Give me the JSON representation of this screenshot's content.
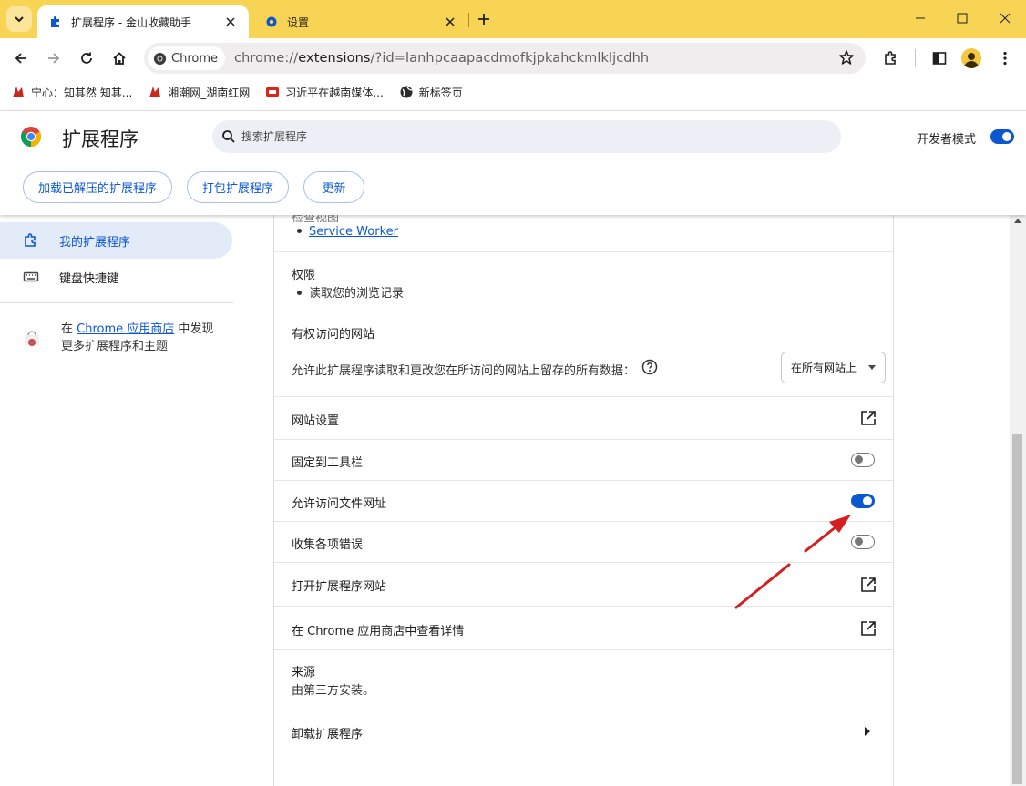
{
  "tabs": {
    "active_title": "扩展程序 - 金山收藏助手",
    "inactive_title": "设置"
  },
  "toolbar": {
    "chip_label": "Chrome",
    "url_scheme": "chrome://",
    "url_host": "extensions",
    "url_rest": "/?id=lanhpcaapacdmofkjpkahckmlkljcdhh"
  },
  "bookmarks": [
    {
      "label": "宁心：知其然 知其...",
      "icon": "brand-icon"
    },
    {
      "label": "湘潮网_湖南红网",
      "icon": "brand-icon"
    },
    {
      "label": "习近平在越南媒体...",
      "icon": "news-icon"
    },
    {
      "label": "新标签页",
      "icon": "globe-icon"
    }
  ],
  "header": {
    "title": "扩展程序",
    "search_placeholder": "搜索扩展程序",
    "dev_mode_label": "开发者模式",
    "dev_mode_on": true,
    "buttons": {
      "load_unpacked": "加载已解压的扩展程序",
      "pack": "打包扩展程序",
      "update": "更新"
    }
  },
  "sidebar": {
    "items": [
      {
        "label": "我的扩展程序",
        "active": true
      },
      {
        "label": "键盘快捷键",
        "active": false
      }
    ],
    "store_prefix": "在",
    "store_link": "Chrome 应用商店",
    "store_suffix": "中发现",
    "store_line2": "更多扩展程序和主题"
  },
  "details": {
    "inspect_heading": "检查视图",
    "service_worker": "Service Worker",
    "permissions_title": "权限",
    "permission_item": "读取您的浏览记录",
    "site_access_title": "有权访问的网站",
    "site_access_desc": "允许此扩展程序读取和更改您在所访问的网站上留存的所有数据：",
    "site_access_value": "在所有网站上",
    "site_settings": "网站设置",
    "pin_toolbar": "固定到工具栏",
    "pin_toolbar_on": false,
    "allow_file_urls": "允许访问文件网址",
    "allow_file_urls_on": true,
    "collect_errors": "收集各项错误",
    "collect_errors_on": false,
    "open_website": "打开扩展程序网站",
    "view_in_store": "在 Chrome 应用商店中查看详情",
    "source_title": "来源",
    "source_value": "由第三方安装。",
    "remove": "卸载扩展程序"
  },
  "colors": {
    "tabstrip": "#f7d454",
    "accent": "#0b57d0",
    "annotation_arrow": "#d42020"
  }
}
